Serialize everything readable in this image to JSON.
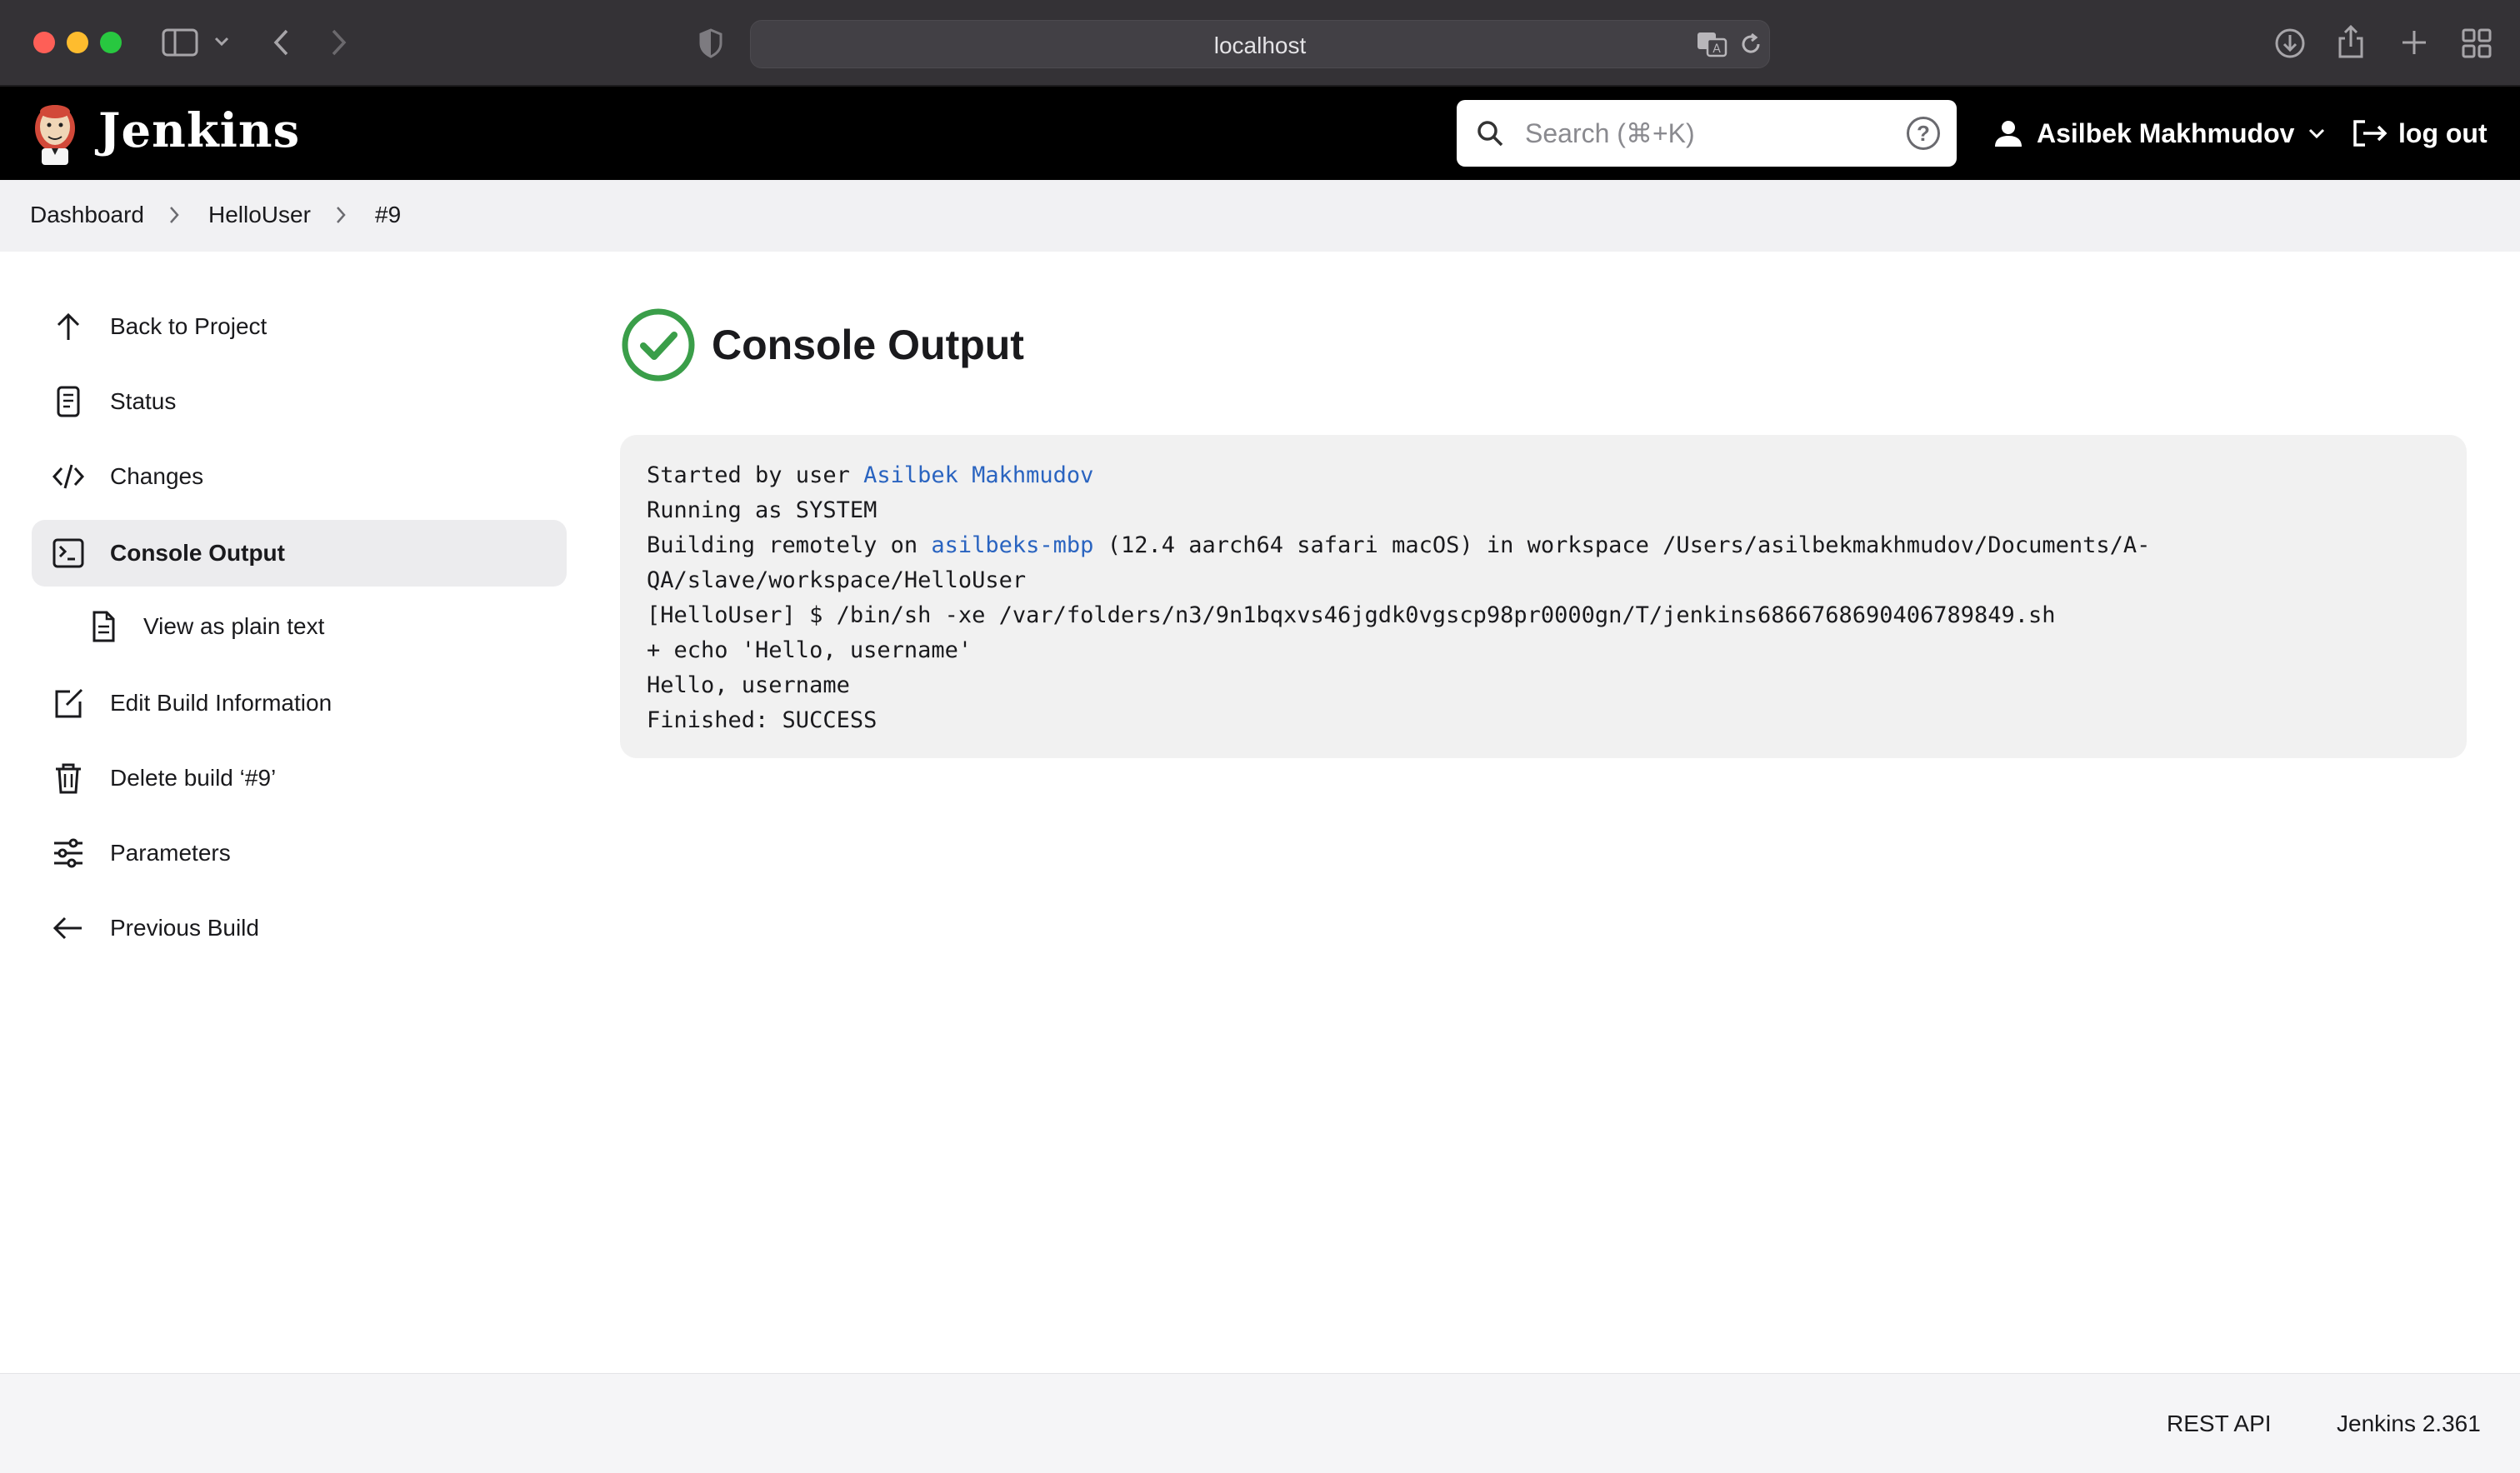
{
  "browser": {
    "url": "localhost"
  },
  "header": {
    "app_title": "Jenkins",
    "search_placeholder": "Search (⌘+K)",
    "help_label": "?",
    "user_name": "Asilbek Makhmudov",
    "logout_label": "log out"
  },
  "breadcrumb": {
    "items": [
      "Dashboard",
      "HelloUser",
      "#9"
    ]
  },
  "sidebar": {
    "items": [
      {
        "label": "Back to Project",
        "icon": "arrow-up-icon"
      },
      {
        "label": "Status",
        "icon": "document-icon"
      },
      {
        "label": "Changes",
        "icon": "code-icon"
      },
      {
        "label": "Console Output",
        "icon": "terminal-icon",
        "active": true
      },
      {
        "label": "View as plain text",
        "icon": "file-icon"
      },
      {
        "label": "Edit Build Information",
        "icon": "edit-icon"
      },
      {
        "label": "Delete build ‘#9’",
        "icon": "trash-icon"
      },
      {
        "label": "Parameters",
        "icon": "sliders-icon"
      },
      {
        "label": "Previous Build",
        "icon": "arrow-left-icon"
      }
    ]
  },
  "main": {
    "title": "Console Output",
    "status": "success",
    "console": {
      "line1_prefix": "Started by user ",
      "line1_link": "Asilbek Makhmudov",
      "line2": "Running as SYSTEM",
      "line3_prefix": "Building remotely on ",
      "line3_link": "asilbeks-mbp",
      "line3_suffix": " (12.4 aarch64 safari macOS) in workspace /Users/asilbekmakhmudov/Documents/A-",
      "line4": "QA/slave/workspace/HelloUser",
      "line5": "[HelloUser] $ /bin/sh -xe /var/folders/n3/9n1bqxvs46jgdk0vgscp98pr0000gn/T/jenkins6866768690406789849.sh",
      "line6": "+ echo 'Hello, username'",
      "line7": "Hello, username",
      "line8": "Finished: SUCCESS"
    }
  },
  "footer": {
    "rest_api": "REST API",
    "version": "Jenkins 2.361"
  },
  "colors": {
    "success": "#3a9e49",
    "link": "#2a64c0",
    "header_bg": "#000000"
  }
}
